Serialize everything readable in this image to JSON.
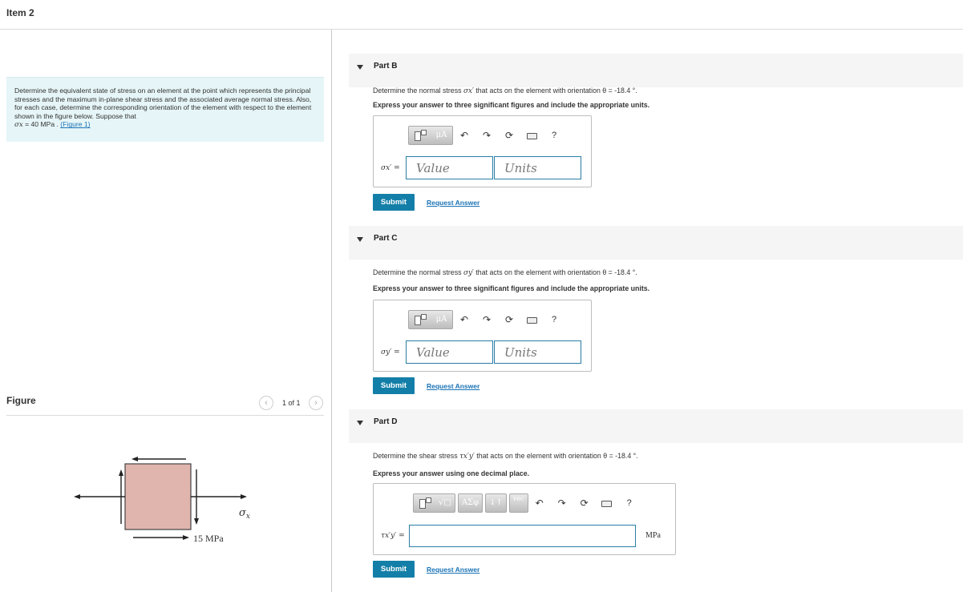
{
  "header": {
    "title": "Item 2"
  },
  "problem": {
    "text": "Determine the equivalent state of stress on an element at the point which represents the principal stresses and the maximum in-plane shear stress and the associated average normal stress. Also, for each case, determine the corresponding orientation of the element with respect to the element shown in the figure below. Suppose that",
    "given_symbol": "σx",
    "given_value": " = 40 MPa . ",
    "figure_link": "(Figure 1)"
  },
  "figure": {
    "label": "Figure",
    "pager": "1 of 1",
    "prev_icon": "chevron-left-icon",
    "next_icon": "chevron-right-icon",
    "stress_label_value": "15 MPa",
    "sigma_label_symbol": "σ",
    "sigma_label_sub": "x",
    "element_color": "#e0b5ae"
  },
  "parts": [
    {
      "title": "Part B",
      "prompt_pre": "Determine the normal stress ",
      "prompt_sym": "σx′",
      "prompt_post": " that acts on the element with orientation θ = -18.4 °.",
      "instructions": "Express your answer to three significant figures and include the appropriate units.",
      "var_label": "σx′ =",
      "value_placeholder": "Value",
      "units_placeholder": "Units",
      "submit": "Submit",
      "request": "Request Answer"
    },
    {
      "title": "Part C",
      "prompt_pre": "Determine the normal stress ",
      "prompt_sym": "σy′",
      "prompt_post": " that acts on the element with orientation θ = -18.4 °.",
      "instructions": "Express your answer to three significant figures and include the appropriate units.",
      "var_label": "σy′ =",
      "value_placeholder": "Value",
      "units_placeholder": "Units",
      "submit": "Submit",
      "request": "Request Answer"
    },
    {
      "title": "Part D",
      "prompt_pre": "Determine the shear stress ",
      "prompt_sym": "τx′y′",
      "prompt_post": " that acts on the element with orientation θ = -18.4 °.",
      "instructions": "Express your answer using one decimal place.",
      "var_label": "τx′y′ =",
      "unit": "MPa",
      "submit": "Submit",
      "request": "Request Answer"
    }
  ],
  "toolbar": {
    "mu_label": "μA",
    "sym_label": "ΑΣφ",
    "arrows_label": "↓↑",
    "vec_label": "vec",
    "help_label": "?",
    "undo_icon": "undo-icon",
    "redo_icon": "redo-icon",
    "reset_icon": "reset-icon",
    "keyboard_icon": "keyboard-icon"
  },
  "colors": {
    "accent": "#137fa8",
    "link": "#1a73b6",
    "problem_bg": "#e6f5f7"
  }
}
